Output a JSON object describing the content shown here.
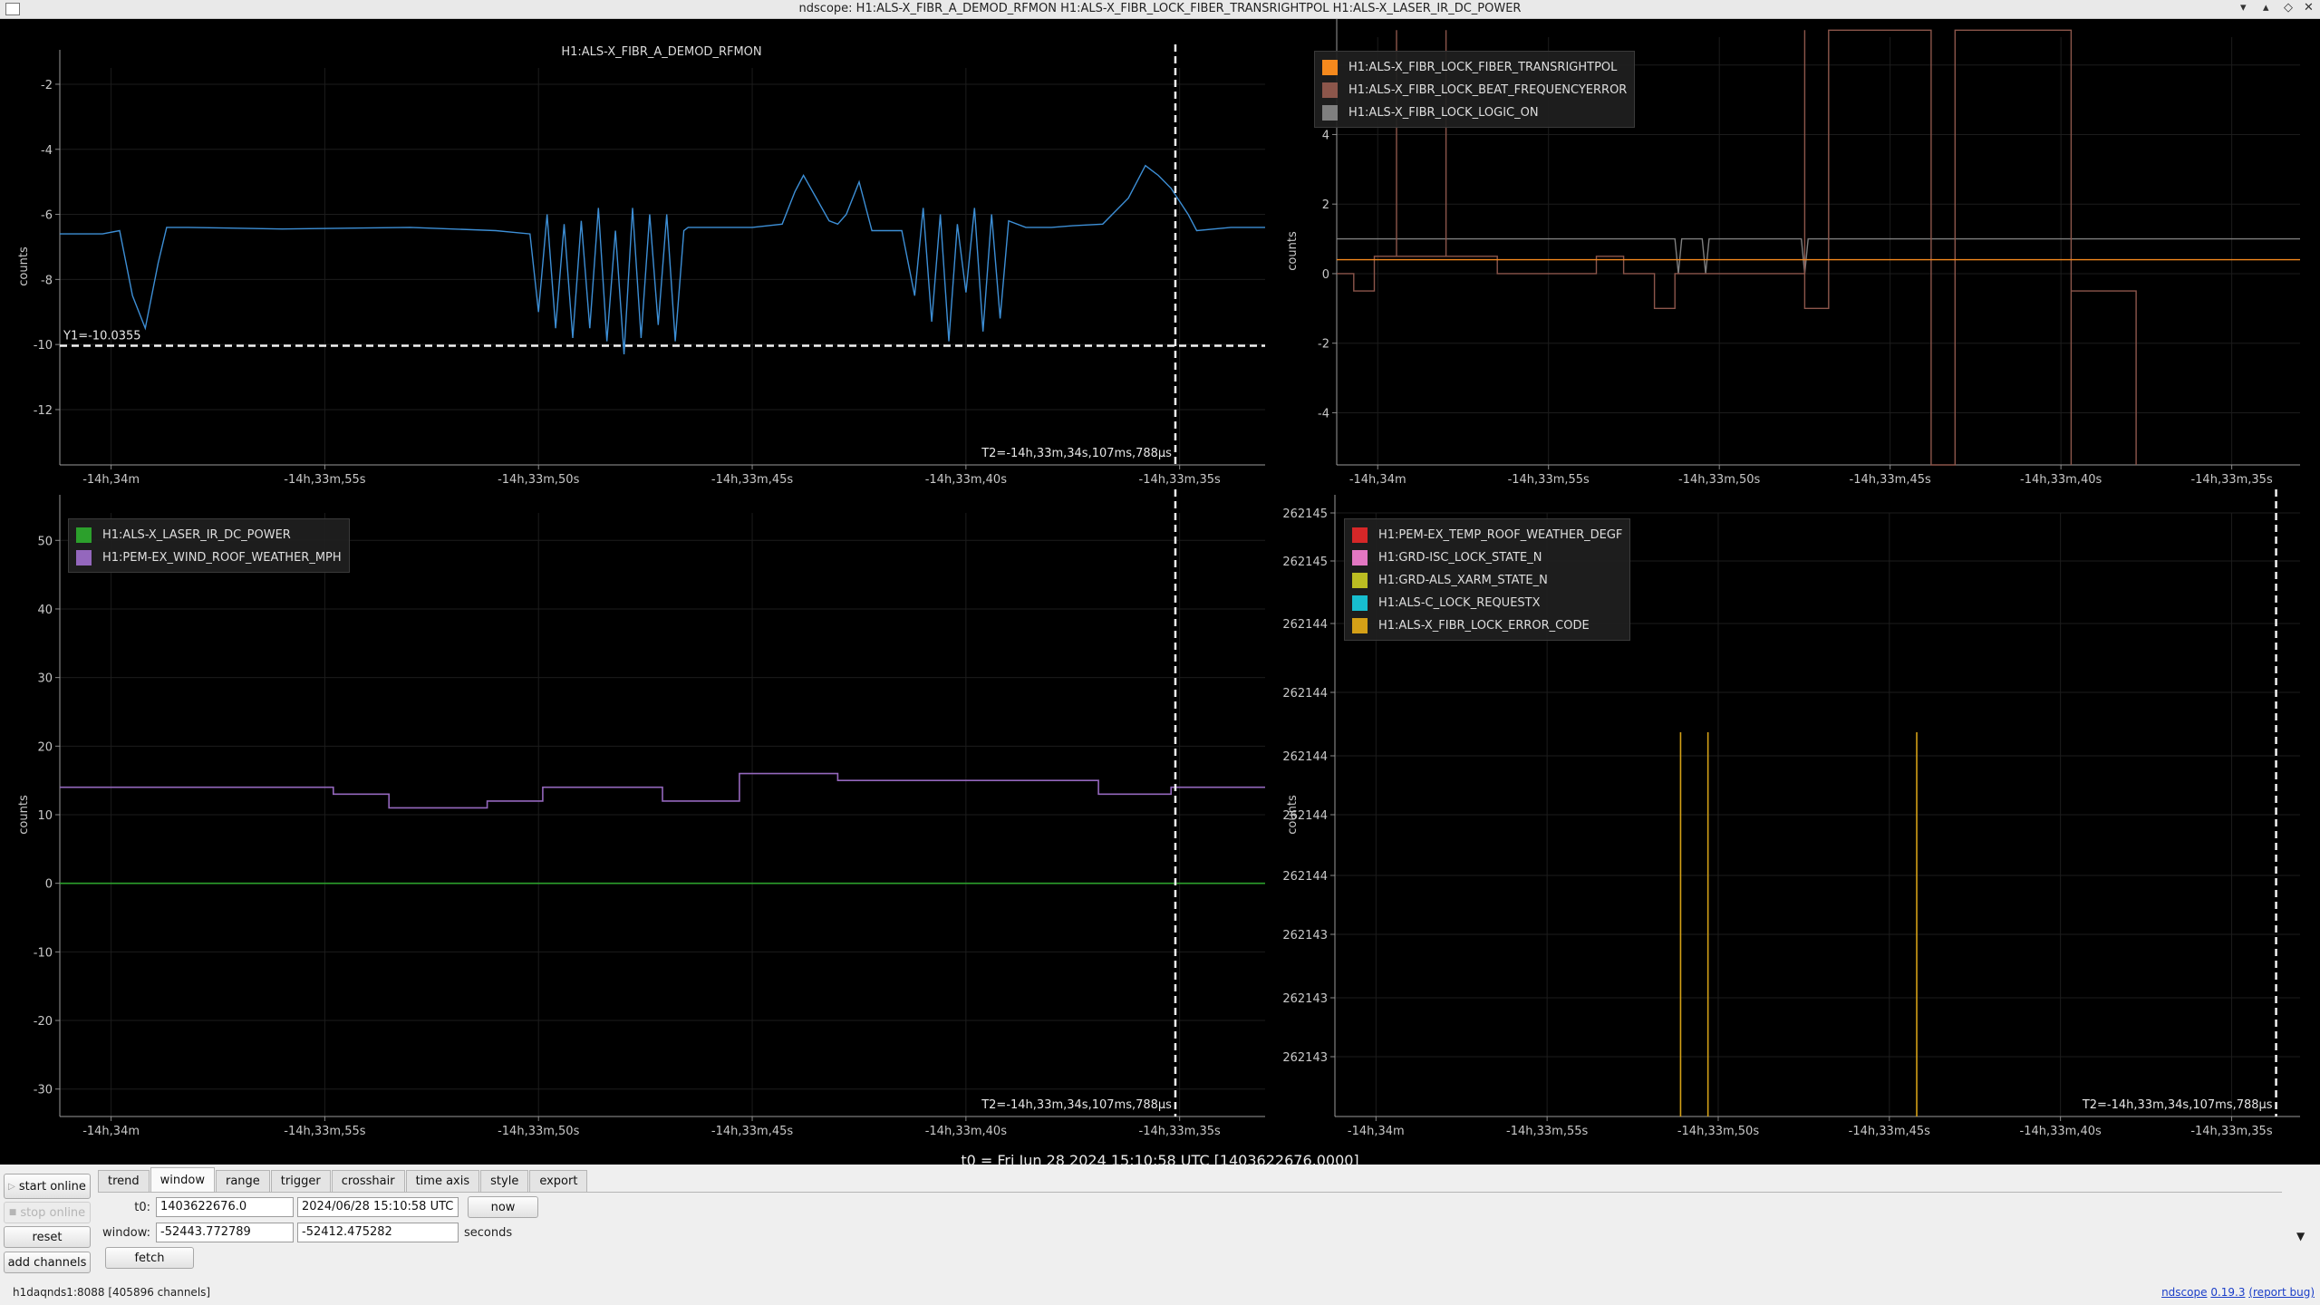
{
  "window": {
    "title": "ndscope: H1:ALS-X_FIBR_A_DEMOD_RFMON H1:ALS-X_FIBR_LOCK_FIBER_TRANSRIGHTPOL H1:ALS-X_LASER_IR_DC_POWER",
    "buttons": {
      "minimize": "▾",
      "maximize": "▴",
      "restore": "◇",
      "close": "✕"
    }
  },
  "x_ticks": [
    "-14h,34m",
    "-14h,33m,55s",
    "-14h,33m,50s",
    "-14h,33m,45s",
    "-14h,33m,40s",
    "-14h,33m,35s"
  ],
  "x_tick_values": [
    -2040,
    -2035,
    -2030,
    -2025,
    -2020,
    -2015
  ],
  "plots": [
    {
      "id": "p1",
      "title": "H1:ALS-X_FIBR_A_DEMOD_RFMON",
      "ylabel": "counts",
      "y_ticks": [
        "-2",
        "-4",
        "-6",
        "-8",
        "-10",
        "-12"
      ],
      "cursor_y_label": "Y1=-10.0355",
      "cursor_t_label": "T2=-14h,33m,34s,107ms,788µs",
      "legend": []
    },
    {
      "id": "p2",
      "title": "",
      "ylabel": "counts",
      "y_ticks": [
        "6",
        "4",
        "2",
        "0",
        "-2",
        "-4"
      ],
      "legend": [
        {
          "label": "H1:ALS-X_FIBR_LOCK_FIBER_TRANSRIGHTPOL",
          "color": "#f5891d"
        },
        {
          "label": "H1:ALS-X_FIBR_LOCK_BEAT_FREQUENCYERROR",
          "color": "#8c564b"
        },
        {
          "label": "H1:ALS-X_FIBR_LOCK_LOGIC_ON",
          "color": "#7f7f7f"
        }
      ]
    },
    {
      "id": "p3",
      "title": "",
      "ylabel": "counts",
      "y_ticks": [
        "50",
        "40",
        "30",
        "20",
        "10",
        "0",
        "-10",
        "-20",
        "-30"
      ],
      "cursor_t_label": "T2=-14h,33m,34s,107ms,788µs",
      "legend": [
        {
          "label": "H1:ALS-X_LASER_IR_DC_POWER",
          "color": "#2ca02c"
        },
        {
          "label": "H1:PEM-EX_WIND_ROOF_WEATHER_MPH",
          "color": "#9467bd"
        }
      ]
    },
    {
      "id": "p4",
      "title": "",
      "ylabel": "counts",
      "y_ticks": [
        "262145",
        "262145",
        "262144",
        "262144",
        "262144",
        "262144",
        "262144",
        "262143",
        "262143",
        "262143"
      ],
      "cursor_t_label": "T2=-14h,33m,34s,107ms,788µs",
      "legend": [
        {
          "label": "H1:PEM-EX_TEMP_ROOF_WEATHER_DEGF",
          "color": "#d62728"
        },
        {
          "label": "H1:GRD-ISC_LOCK_STATE_N",
          "color": "#e377c2"
        },
        {
          "label": "H1:GRD-ALS_XARM_STATE_N",
          "color": "#bcbd22"
        },
        {
          "label": "H1:ALS-C_LOCK_REQUESTX",
          "color": "#17becf"
        },
        {
          "label": "H1:ALS-X_FIBR_LOCK_ERROR_CODE",
          "color": "#d4a017"
        }
      ]
    }
  ],
  "t0_label": "t0 = Fri Jun 28 2024 15:10:58 UTC [1403622676.0000]",
  "controls": {
    "start_online": "start online",
    "stop_online": "stop online",
    "reset": "reset",
    "add_channels": "add channels",
    "tabs": [
      "trend",
      "window",
      "range",
      "trigger",
      "crosshair",
      "time axis",
      "style",
      "export"
    ],
    "active_tab": "window",
    "t0_label": "t0:",
    "t0_gps": "1403622676.0",
    "t0_utc": "2024/06/28 15:10:58 UTC",
    "now": "now",
    "window_label": "window:",
    "window_start": "-52443.772789",
    "window_end": "-52412.475282",
    "seconds": "seconds",
    "fetch": "fetch"
  },
  "status": {
    "server": "h1daqnds1:8088",
    "channels": "[405896 channels]",
    "version_name": "ndscope",
    "version_number": "0.19.3",
    "report_bug": "(report bug)"
  },
  "chart_data": [
    {
      "type": "line",
      "title": "H1:ALS-X_FIBR_A_DEMOD_RFMON",
      "ylabel": "counts",
      "xlim": [
        -2041.2,
        -2013.0
      ],
      "ylim": [
        -13.7,
        -1.5
      ],
      "series": [
        {
          "name": "H1:ALS-X_FIBR_A_DEMOD_RFMON",
          "color": "#3d8fd6",
          "x": [
            -2041.2,
            -2040.2,
            -2039.8,
            -2039.5,
            -2039.2,
            -2038.9,
            -2038.7,
            -2038.5,
            -2038.2,
            -2036.0,
            -2033.0,
            -2031.0,
            -2030.2,
            -2030.0,
            -2029.8,
            -2029.6,
            -2029.4,
            -2029.2,
            -2029.0,
            -2028.8,
            -2028.6,
            -2028.4,
            -2028.2,
            -2028.0,
            -2027.8,
            -2027.6,
            -2027.4,
            -2027.2,
            -2027.0,
            -2026.8,
            -2026.6,
            -2026.5,
            -2026.3,
            -2025.0,
            -2024.3,
            -2024.0,
            -2023.8,
            -2023.5,
            -2023.2,
            -2023.0,
            -2022.8,
            -2022.5,
            -2022.2,
            -2021.5,
            -2021.2,
            -2021.0,
            -2020.8,
            -2020.6,
            -2020.4,
            -2020.2,
            -2020.0,
            -2019.8,
            -2019.6,
            -2019.4,
            -2019.2,
            -2019.0,
            -2018.6,
            -2018.0,
            -2017.5,
            -2016.8,
            -2016.2,
            -2015.8,
            -2015.5,
            -2015.2,
            -2015.0,
            -2014.8,
            -2014.6,
            -2013.8,
            -2013.0
          ],
          "y": [
            -6.6,
            -6.6,
            -6.5,
            -8.5,
            -9.5,
            -7.5,
            -6.4,
            -6.4,
            -6.4,
            -6.45,
            -6.4,
            -6.5,
            -6.6,
            -9.0,
            -6.0,
            -9.5,
            -6.3,
            -9.8,
            -6.2,
            -9.5,
            -5.8,
            -9.9,
            -6.5,
            -10.3,
            -5.8,
            -9.8,
            -6.0,
            -9.4,
            -6.0,
            -9.9,
            -6.5,
            -6.4,
            -6.4,
            -6.4,
            -6.3,
            -5.3,
            -4.8,
            -5.5,
            -6.2,
            -6.3,
            -6.0,
            -5.0,
            -6.5,
            -6.5,
            -8.5,
            -5.8,
            -9.3,
            -6.0,
            -9.9,
            -6.3,
            -8.4,
            -5.8,
            -9.6,
            -6.0,
            -9.2,
            -6.2,
            -6.4,
            -6.4,
            -6.35,
            -6.3,
            -5.5,
            -4.5,
            -4.8,
            -5.2,
            -5.6,
            -6.0,
            -6.5,
            -6.4,
            -6.4
          ]
        },
        {
          "name": "Y1",
          "x": [
            -2041.2,
            -2013.0
          ],
          "y": [
            -10.0355,
            -10.0355
          ]
        }
      ]
    },
    {
      "type": "line",
      "ylabel": "counts",
      "xlim": [
        -2041.2,
        -2013.0
      ],
      "ylim": [
        -5.5,
        6.8
      ],
      "series": [
        {
          "name": "H1:ALS-X_FIBR_LOCK_FIBER_TRANSRIGHTPOL",
          "color": "#f5891d",
          "x": [
            -2041.2,
            -2013.0
          ],
          "y": [
            0.4,
            0.4
          ]
        },
        {
          "name": "H1:ALS-X_FIBR_LOCK_BEAT_FREQUENCYERROR",
          "color": "#8c564b",
          "x": [
            -2041.2,
            -2040.7,
            -2040.7,
            -2040.1,
            -2040.1,
            -2039.45,
            -2039.45,
            -2039.45,
            -2038.0,
            -2038.0,
            -2038.0,
            -2036.5,
            -2036.5,
            -2033.6,
            -2033.6,
            -2032.8,
            -2032.8,
            -2031.9,
            -2031.9,
            -2031.3,
            -2031.3,
            -2027.5,
            -2027.5,
            -2027.5,
            -2026.8,
            -2026.8,
            -2023.8,
            -2023.8,
            -2023.8,
            -2023.1,
            -2023.1,
            -2019.7,
            -2019.7,
            -2019.7,
            -2018.4,
            -2018.4,
            -2017.8,
            -2017.8,
            -2017.8
          ],
          "y": [
            0,
            0,
            -0.5,
            -0.5,
            0.5,
            0.5,
            7,
            0.5,
            0.5,
            7,
            0.5,
            0.5,
            0,
            0,
            0.5,
            0.5,
            0,
            0,
            -1,
            -1,
            0,
            0,
            7,
            -1,
            -1,
            7,
            7,
            -1,
            -5.5,
            -5.5,
            7,
            7,
            -5.5,
            -0.5,
            -0.5,
            -0.5,
            -0.5,
            -5.5,
            -5.5
          ]
        },
        {
          "name": "H1:ALS-X_FIBR_LOCK_LOGIC_ON",
          "color": "#7f7f7f",
          "x": [
            -2041.2,
            -2031.3,
            -2031.2,
            -2031.1,
            -2030.5,
            -2030.4,
            -2030.3,
            -2027.6,
            -2027.5,
            -2027.4,
            -2013.0
          ],
          "y": [
            1,
            1,
            0,
            1,
            1,
            0,
            1,
            1,
            0,
            1,
            1
          ]
        }
      ]
    },
    {
      "type": "line",
      "ylabel": "counts",
      "xlim": [
        -2041.2,
        -2013.0
      ],
      "ylim": [
        -34,
        54
      ],
      "series": [
        {
          "name": "H1:ALS-X_LASER_IR_DC_POWER",
          "color": "#2ca02c",
          "x": [
            -2041.2,
            -2013.0
          ],
          "y": [
            0,
            0
          ]
        },
        {
          "name": "H1:PEM-EX_WIND_ROOF_WEATHER_MPH",
          "color": "#9467bd",
          "x": [
            -2041.2,
            -2034.8,
            -2034.8,
            -2033.5,
            -2033.5,
            -2031.2,
            -2031.2,
            -2029.9,
            -2029.9,
            -2027.1,
            -2027.1,
            -2025.3,
            -2025.3,
            -2023.0,
            -2023.0,
            -2016.9,
            -2016.9,
            -2015.2,
            -2015.2,
            -2013.0
          ],
          "y": [
            14,
            14,
            13,
            13,
            11,
            11,
            12,
            12,
            14,
            14,
            12,
            12,
            16,
            16,
            15,
            15,
            13,
            13,
            14,
            14
          ]
        }
      ]
    },
    {
      "type": "line",
      "ylabel": "counts",
      "xlim": [
        -2041.2,
        -2013.0
      ],
      "series": [
        {
          "name": "H1:ALS-X_FIBR_LOCK_ERROR_CODE",
          "color": "#d4a017",
          "x": [
            -2031.1,
            -2030.3,
            -2024.2
          ],
          "y": [
            262144,
            262144,
            262144
          ]
        }
      ]
    }
  ]
}
